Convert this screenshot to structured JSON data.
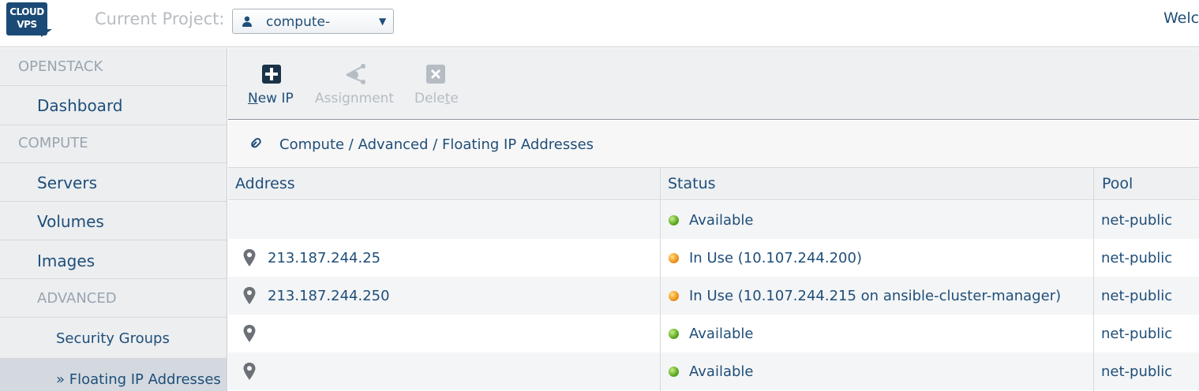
{
  "header": {
    "logo_line1": "CLOUD",
    "logo_line2": "VPS",
    "project_label": "Current Project:",
    "project_value": "compute-",
    "welcome": "Welc"
  },
  "sidebar": {
    "items": [
      {
        "label": "OPENSTACK",
        "kind": "section"
      },
      {
        "label": "Dashboard",
        "kind": "link"
      },
      {
        "label": "COMPUTE",
        "kind": "section"
      },
      {
        "label": "Servers",
        "kind": "link"
      },
      {
        "label": "Volumes",
        "kind": "link"
      },
      {
        "label": "Images",
        "kind": "link"
      },
      {
        "label": "ADVANCED",
        "kind": "section"
      },
      {
        "label": "Security Groups",
        "kind": "sub"
      },
      {
        "label": "» Floating IP Addresses",
        "kind": "sub-active"
      }
    ]
  },
  "toolbar": {
    "new_ip": "New IP",
    "assignment": "Assignment",
    "delete": "Delete"
  },
  "breadcrumb": {
    "path": "Compute / Advanced / Floating IP Addresses"
  },
  "table": {
    "columns": [
      "Address",
      "Status",
      "Pool"
    ],
    "rows": [
      {
        "address": "",
        "status": "Available",
        "status_color": "green",
        "pool": "net-public",
        "pin": false
      },
      {
        "address": "213.187.244.25",
        "status": "In Use (10.107.244.200)",
        "status_color": "orange",
        "pool": "net-public",
        "pin": true
      },
      {
        "address": "213.187.244.250",
        "status": "In Use (10.107.244.215 on ansible-cluster-manager)",
        "status_color": "orange",
        "pool": "net-public",
        "pin": true
      },
      {
        "address": "",
        "status": "Available",
        "status_color": "green",
        "pool": "net-public",
        "pin": true
      },
      {
        "address": "",
        "status": "Available",
        "status_color": "green",
        "pool": "net-public",
        "pin": true
      }
    ]
  },
  "colors": {
    "brand": "#1a4a75",
    "text": "#1f4e79",
    "available": "#5aa81f",
    "in_use": "#f09a1e"
  }
}
